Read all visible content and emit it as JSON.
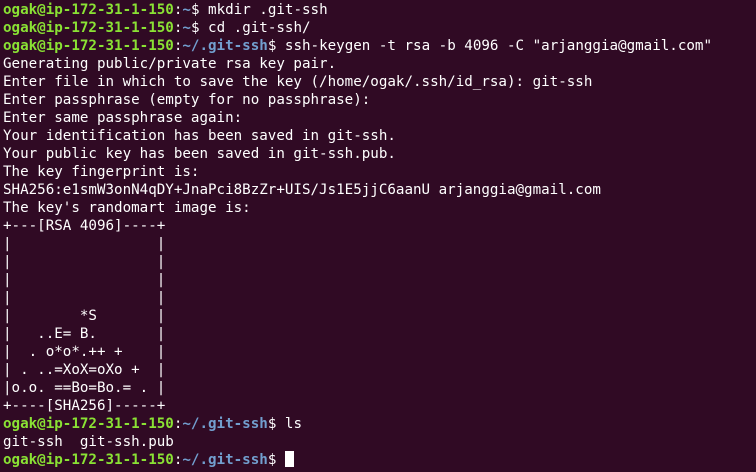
{
  "theme": {
    "background": "#300a24",
    "prompt_user_color": "#8ae234",
    "prompt_path_color": "#729fcf",
    "text_color": "#ffffff"
  },
  "prompt": {
    "userhost": "ogak@ip-172-31-1-150",
    "separator": ":",
    "dollar": "$ "
  },
  "lines": [
    {
      "type": "prompt",
      "path": "~",
      "command": "mkdir .git-ssh"
    },
    {
      "type": "prompt",
      "path": "~",
      "command": "cd .git-ssh/"
    },
    {
      "type": "prompt",
      "path": "~/.git-ssh",
      "command": "ssh-keygen -t rsa -b 4096 -C \"arjanggia@gmail.com\""
    },
    {
      "type": "output",
      "text": "Generating public/private rsa key pair."
    },
    {
      "type": "output",
      "text": "Enter file in which to save the key (/home/ogak/.ssh/id_rsa): git-ssh"
    },
    {
      "type": "output",
      "text": "Enter passphrase (empty for no passphrase):"
    },
    {
      "type": "output",
      "text": "Enter same passphrase again:"
    },
    {
      "type": "output",
      "text": "Your identification has been saved in git-ssh."
    },
    {
      "type": "output",
      "text": "Your public key has been saved in git-ssh.pub."
    },
    {
      "type": "output",
      "text": "The key fingerprint is:"
    },
    {
      "type": "output",
      "text": "SHA256:e1smW3onN4qDY+JnaPci8BzZr+UIS/Js1E5jjC6aanU arjanggia@gmail.com"
    },
    {
      "type": "output",
      "text": "The key's randomart image is:"
    },
    {
      "type": "output",
      "text": "+---[RSA 4096]----+"
    },
    {
      "type": "output",
      "text": "|                 |"
    },
    {
      "type": "output",
      "text": "|                 |"
    },
    {
      "type": "output",
      "text": "|                 |"
    },
    {
      "type": "output",
      "text": "|                 |"
    },
    {
      "type": "output",
      "text": "|        *S       |"
    },
    {
      "type": "output",
      "text": "|   ..E= B.       |"
    },
    {
      "type": "output",
      "text": "|  . o*o*.++ +    |"
    },
    {
      "type": "output",
      "text": "| . ..=XoX=oXo +  |"
    },
    {
      "type": "output",
      "text": "|o.o. ==Bo=Bo.= . |"
    },
    {
      "type": "output",
      "text": "+----[SHA256]-----+"
    },
    {
      "type": "prompt",
      "path": "~/.git-ssh",
      "command": "ls"
    },
    {
      "type": "output",
      "text": "git-ssh  git-ssh.pub"
    },
    {
      "type": "prompt",
      "path": "~/.git-ssh",
      "command": "",
      "cursor": true
    }
  ]
}
